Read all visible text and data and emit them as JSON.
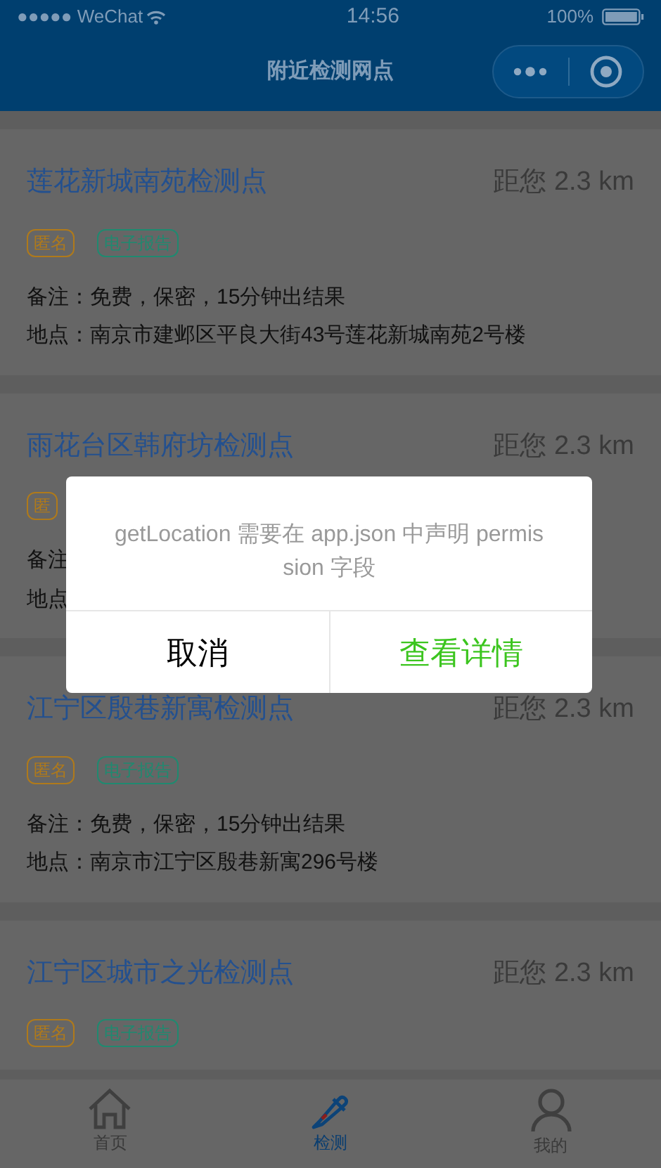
{
  "status_bar": {
    "carrier": "●●●●● WeChat",
    "time": "14:56",
    "battery": "100%"
  },
  "nav_bar": {
    "title": "附近检测网点"
  },
  "sites": [
    {
      "name": "莲花新城南苑检测点",
      "distance": "距您 2.3 km",
      "tags": [
        {
          "label": "匿名",
          "color": "#b07a1a"
        },
        {
          "label": "电子报告",
          "color": "#1f8a70"
        }
      ],
      "note": "备注：免费，保密，15分钟出结果",
      "address": "地点：南京市建邺区平良大街43号莲花新城南苑2号楼"
    },
    {
      "name": "雨花台区韩府坊检测点",
      "distance": "距您 2.3 km",
      "tags": [
        {
          "label": "匿",
          "color": "#b07a1a"
        }
      ],
      "note": "备注",
      "address": "地点"
    },
    {
      "name": "江宁区殷巷新寓检测点",
      "distance": "距您 2.3 km",
      "tags": [
        {
          "label": "匿名",
          "color": "#b07a1a"
        },
        {
          "label": "电子报告",
          "color": "#1f8a70"
        }
      ],
      "note": "备注：免费，保密，15分钟出结果",
      "address": "地点：南京市江宁区殷巷新寓296号楼"
    },
    {
      "name": "江宁区城市之光检测点",
      "distance": "距您 2.3 km",
      "tags": [
        {
          "label": "匿名",
          "color": "#b07a1a"
        },
        {
          "label": "电子报告",
          "color": "#1f8a70"
        }
      ]
    }
  ],
  "dialog": {
    "message": "getLocation 需要在 app.json 中声明 permission 字段",
    "cancel": "取消",
    "confirm": "查看详情"
  },
  "tab_bar": [
    {
      "label": "首页",
      "selected": false
    },
    {
      "label": "检测",
      "selected": true
    },
    {
      "label": "我的",
      "selected": false
    }
  ]
}
